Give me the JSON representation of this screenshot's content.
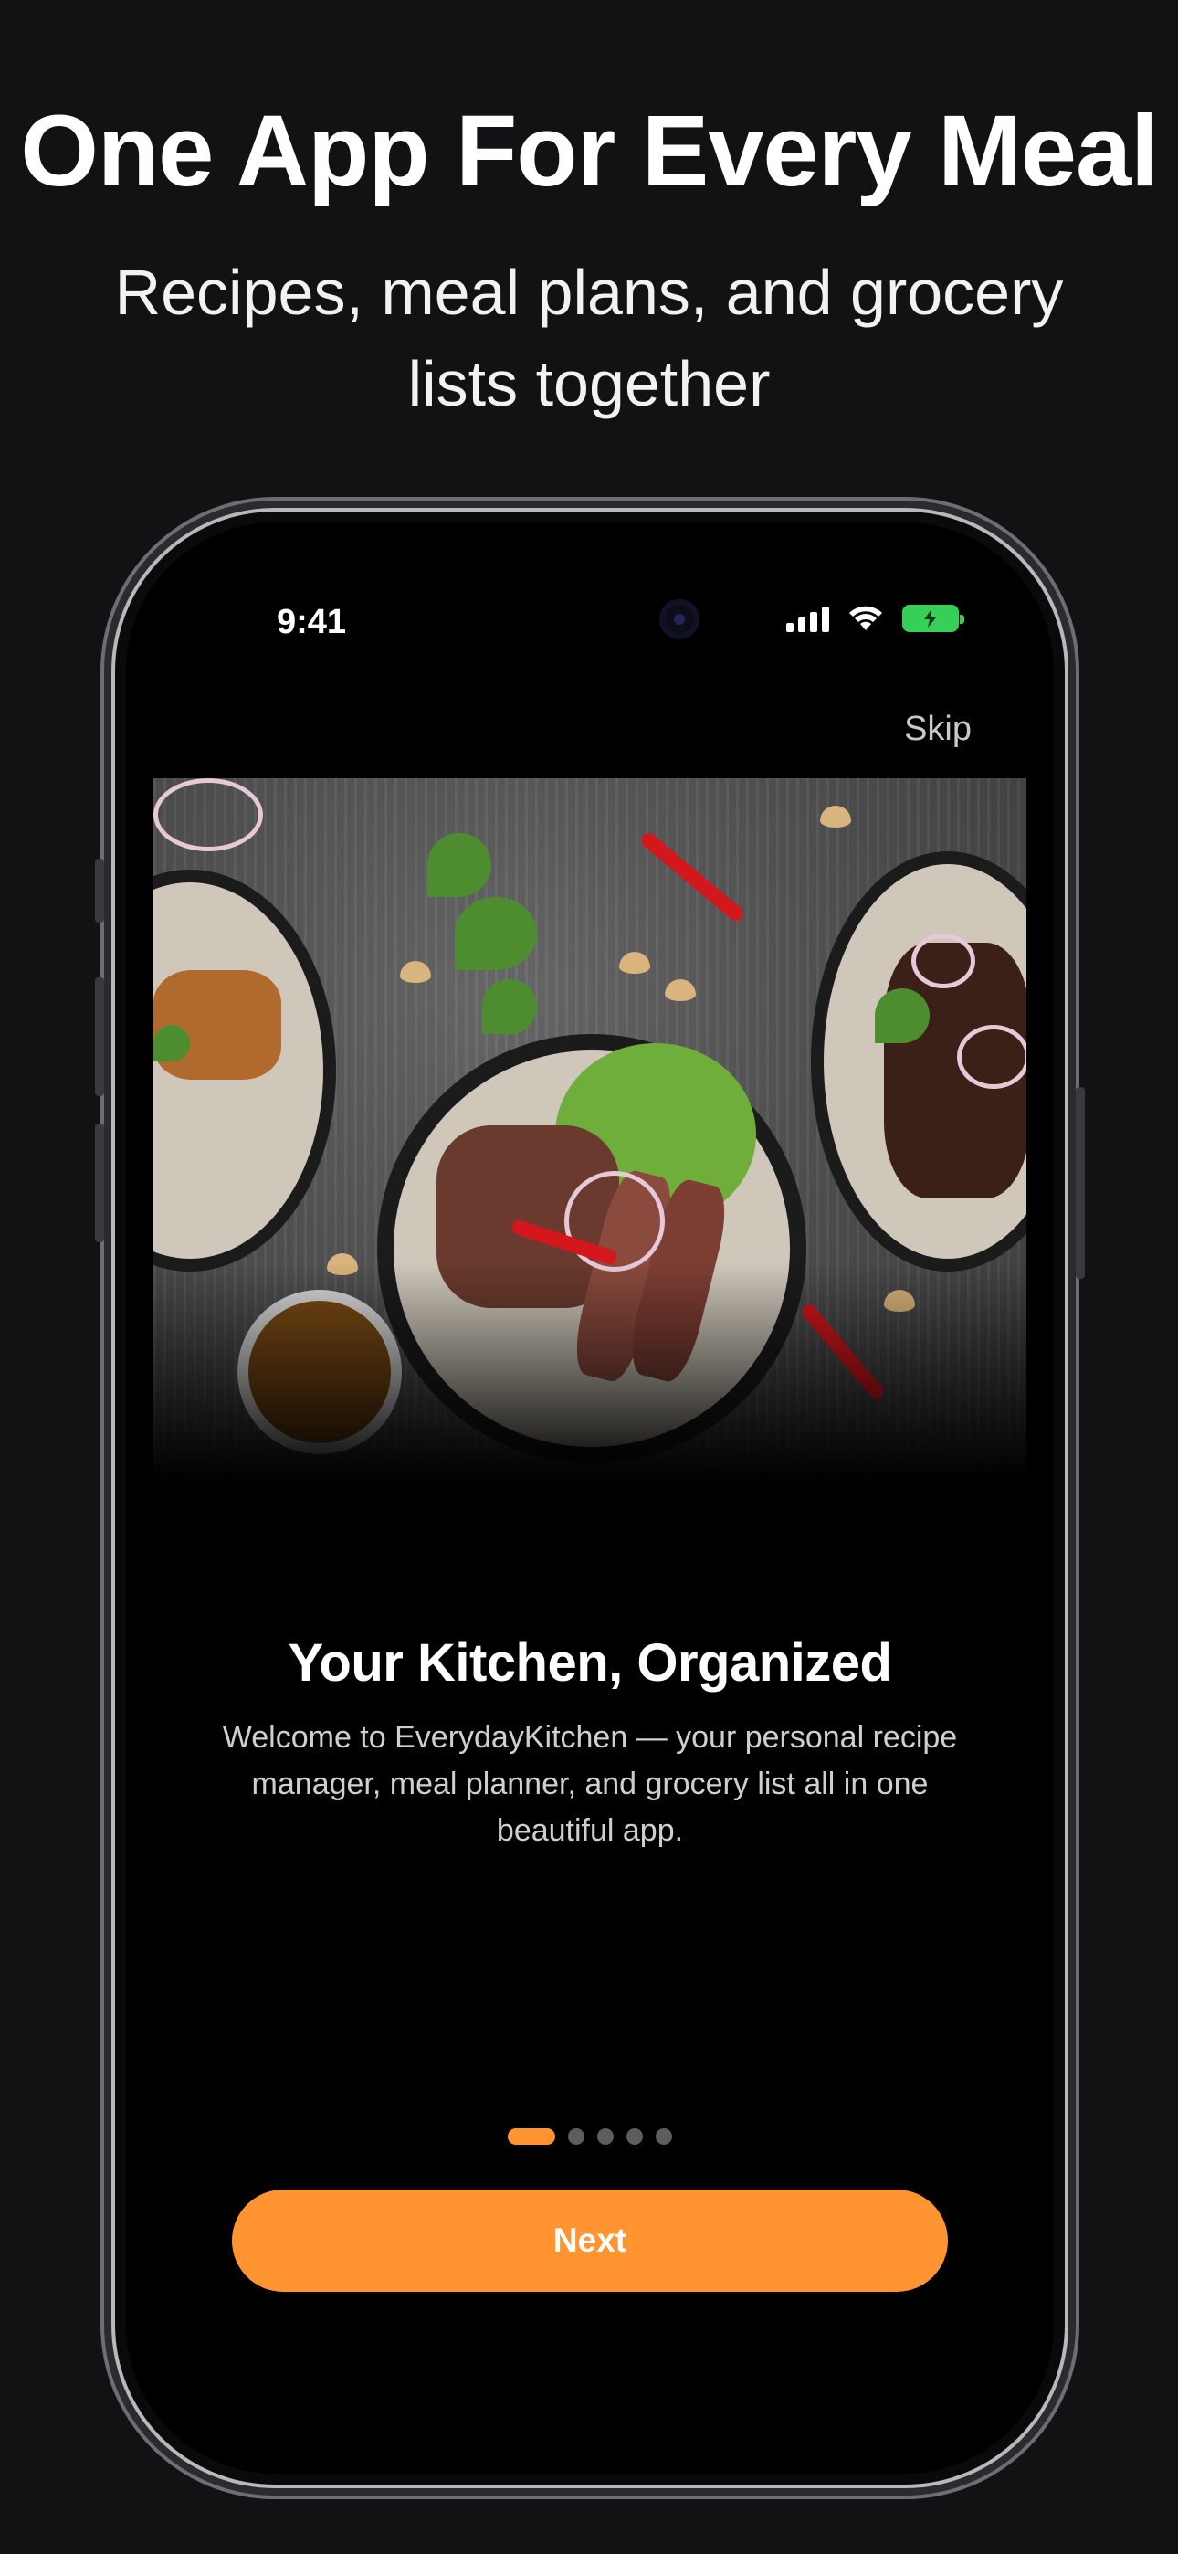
{
  "promo": {
    "headline": "One App For Every Meal",
    "subheadline": "Recipes, meal plans, and grocery lists together"
  },
  "status_bar": {
    "time": "9:41",
    "battery_color": "#35d058"
  },
  "onboarding": {
    "skip_label": "Skip",
    "title": "Your Kitchen, Organized",
    "description": "Welcome to EverydayKitchen — your personal recipe manager, meal planner, and grocery list all in one beautiful app.",
    "page_index": 1,
    "page_count": 5,
    "next_label": "Next",
    "accent_color": "#ff9430"
  }
}
